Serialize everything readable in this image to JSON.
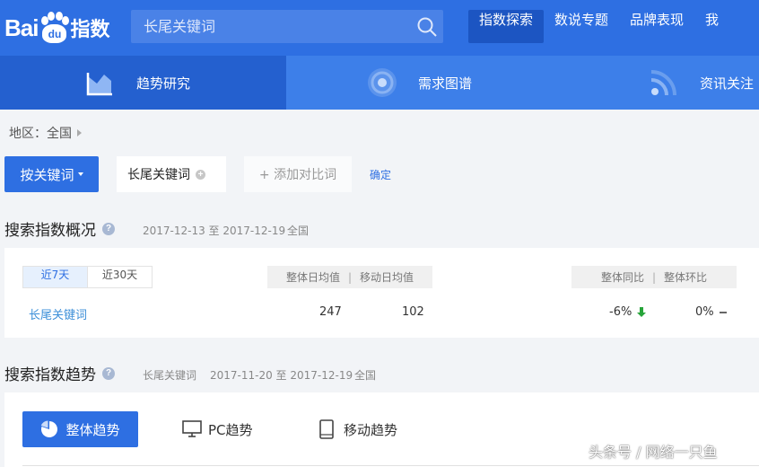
{
  "logo": {
    "part1": "Bai",
    "paw_text": "du",
    "part2": "指数"
  },
  "search": {
    "placeholder": "长尾关键词"
  },
  "nav": [
    "指数探索",
    "数说专题",
    "品牌表现",
    "我"
  ],
  "subnav": [
    "趋势研究",
    "需求图谱",
    "资讯关注"
  ],
  "region": {
    "label": "地区：全国"
  },
  "keyword_row": {
    "mode_button": "按关键词",
    "keyword": "长尾关键词",
    "add_compare": "+ 添加对比词",
    "confirm": "确定"
  },
  "overview": {
    "title": "搜索指数概况",
    "date_range": "2017-12-13 至 2017-12-19",
    "region": "全国",
    "periods": [
      "近7天",
      "近30天"
    ],
    "header_avg": [
      "整体日均值",
      "移动日均值"
    ],
    "header_compare": [
      "整体同比",
      "整体环比"
    ],
    "row": {
      "keyword": "长尾关键词",
      "overall_avg": "247",
      "mobile_avg": "102",
      "yoy": "-6%",
      "mom": "0%"
    }
  },
  "trend": {
    "title": "搜索指数趋势",
    "keyword": "长尾关键词",
    "date_range": "2017-11-20 至 2017-12-19",
    "region": "全国",
    "tabs": [
      "整体趋势",
      "PC趋势",
      "移动趋势"
    ]
  },
  "watermark": "头条号 / 网络一只鱼",
  "colors": {
    "brand": "#2e6fe2",
    "subnav": "#3d7fe9",
    "down": "#27a43a",
    "link": "#3c8fd8"
  }
}
